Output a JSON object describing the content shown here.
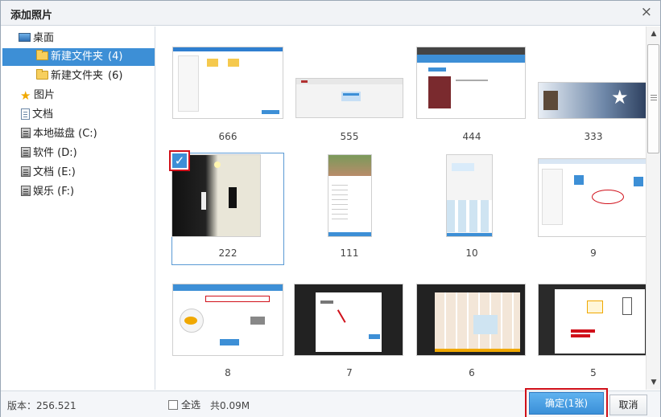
{
  "dialog": {
    "title": "添加照片",
    "close_symbol": "×"
  },
  "sidebar": {
    "items": [
      {
        "label": "桌面",
        "icon": "desktop-icon"
      },
      {
        "label": "新建文件夹",
        "count": "(4)",
        "icon": "folder-icon",
        "selected": true
      },
      {
        "label": "新建文件夹",
        "count": "(6)",
        "icon": "folder-icon"
      },
      {
        "label": "图片",
        "icon": "star-icon"
      },
      {
        "label": "文档",
        "icon": "document-icon"
      },
      {
        "label": "本地磁盘 (C:)",
        "icon": "disk-icon"
      },
      {
        "label": "软件 (D:)",
        "icon": "disk-icon"
      },
      {
        "label": "文档 (E:)",
        "icon": "disk-icon"
      },
      {
        "label": "娱乐 (F:)",
        "icon": "disk-icon"
      }
    ]
  },
  "photos": [
    {
      "name": "666"
    },
    {
      "name": "555"
    },
    {
      "name": "444"
    },
    {
      "name": "333"
    },
    {
      "name": "222",
      "checked": true
    },
    {
      "name": "111"
    },
    {
      "name": "10"
    },
    {
      "name": "9"
    },
    {
      "name": "8"
    },
    {
      "name": "7"
    },
    {
      "name": "6"
    },
    {
      "name": "5"
    }
  ],
  "footer": {
    "version": "版本：256.521",
    "select_all": "全选",
    "total": "共0.09M",
    "confirm": "确定(1张)",
    "cancel": "取消"
  },
  "colors": {
    "accent": "#3d8fd6",
    "highlight_border": "#d0101a"
  }
}
